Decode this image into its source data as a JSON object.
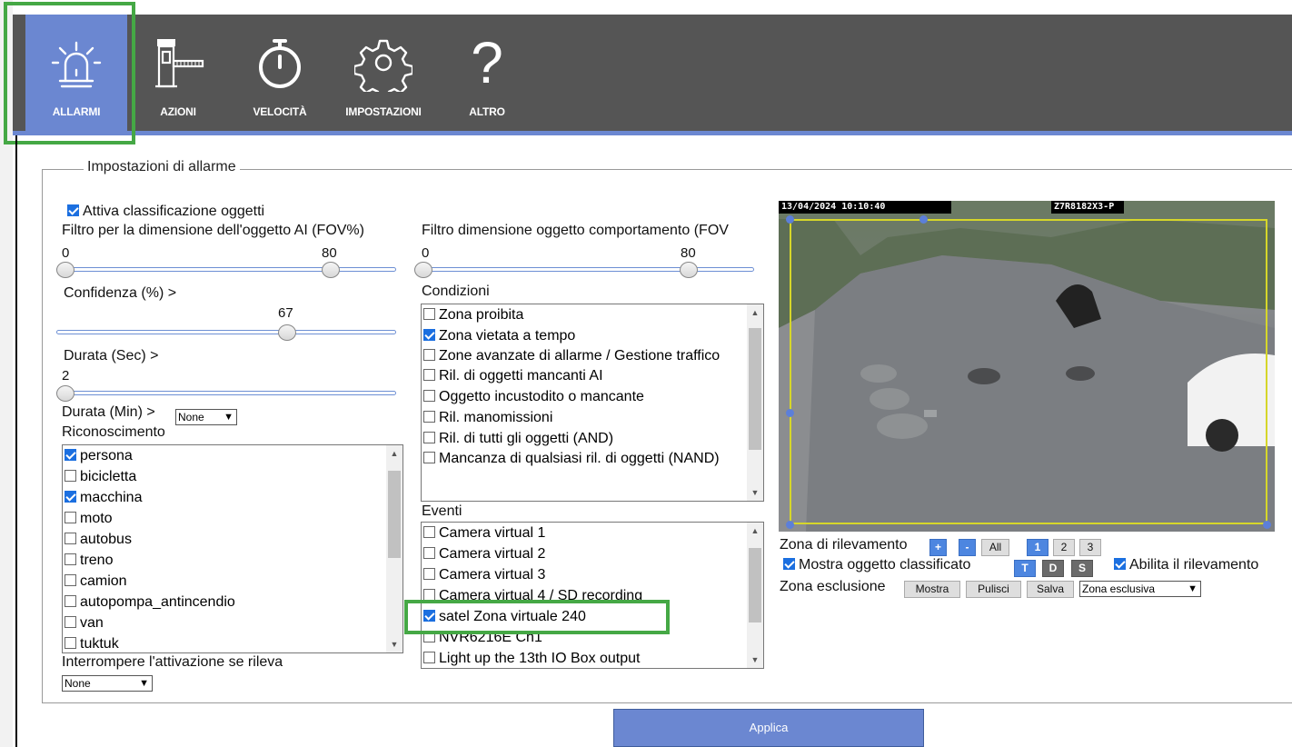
{
  "nav": {
    "tabs": [
      {
        "label": "ALLARMI",
        "icon": "siren-icon",
        "active": true
      },
      {
        "label": "AZIONI",
        "icon": "barrier-icon"
      },
      {
        "label": "VELOCITÀ",
        "icon": "stopwatch-icon"
      },
      {
        "label": "IMPOSTAZIONI",
        "icon": "gear-icon"
      },
      {
        "label": "ALTRO",
        "icon": "question-icon"
      }
    ],
    "accent_color": "#6b87d1",
    "bar_color": "#555555",
    "highlight_color": "#45a845"
  },
  "settings": {
    "legend": "Impostazioni di allarme",
    "object_classification_label": "Attiva classificazione oggetti",
    "object_classification_checked": true,
    "ai_size_filter": {
      "label": "Filtro per la dimensione dell'oggetto AI (FOV%)",
      "min_label": "0",
      "max_label": "80",
      "min": 0,
      "max": 80
    },
    "behavior_size_filter": {
      "label": "Filtro dimensione oggetto comportamento (FOV",
      "min_label": "0",
      "max_label": "80",
      "min": 0,
      "max": 80
    },
    "confidence": {
      "label": "Confidenza (%) >",
      "value_label": "67",
      "value": 67
    },
    "duration_sec": {
      "label": "Durata (Sec) >",
      "value_label": "2",
      "value": 2
    },
    "duration_min": {
      "label": "Durata (Min) >",
      "selected": "None"
    },
    "recognition": {
      "label": "Riconoscimento",
      "items": [
        {
          "label": "persona",
          "checked": true
        },
        {
          "label": "bicicletta",
          "checked": false
        },
        {
          "label": "macchina",
          "checked": true
        },
        {
          "label": "moto",
          "checked": false
        },
        {
          "label": "autobus",
          "checked": false
        },
        {
          "label": "treno",
          "checked": false
        },
        {
          "label": "camion",
          "checked": false
        },
        {
          "label": "autopompa_antincendio",
          "checked": false
        },
        {
          "label": "van",
          "checked": false
        },
        {
          "label": "tuktuk",
          "checked": false
        }
      ]
    },
    "interrupt": {
      "label": "Interrompere l'attivazione se rileva",
      "selected": "None"
    },
    "conditions": {
      "label": "Condizioni",
      "items": [
        {
          "label": "Zona proibita",
          "checked": false
        },
        {
          "label": "Zona vietata a tempo",
          "checked": true
        },
        {
          "label": "Zone avanzate di allarme / Gestione traffico",
          "checked": false
        },
        {
          "label": "Ril. di oggetti mancanti AI",
          "checked": false
        },
        {
          "label": "Oggetto incustodito o mancante",
          "checked": false
        },
        {
          "label": "Ril. manomissioni",
          "checked": false
        },
        {
          "label": "Ril. di tutti gli oggetti (AND)",
          "checked": false
        },
        {
          "label": "Mancanza di qualsiasi ril. di oggetti (NAND)",
          "checked": false
        }
      ]
    },
    "events": {
      "label": "Eventi",
      "items": [
        {
          "label": "Camera virtual 1",
          "checked": false
        },
        {
          "label": "Camera virtual 2",
          "checked": false
        },
        {
          "label": "Camera virtual 3",
          "checked": false
        },
        {
          "label": "Camera virtual 4 / SD recording",
          "checked": false
        },
        {
          "label": "satel Zona virtuale 240",
          "checked": true
        },
        {
          "label": "NVR6216E Ch1",
          "checked": false
        },
        {
          "label": "Light up the 13th IO Box output",
          "checked": false
        }
      ]
    }
  },
  "video": {
    "timestamp": "13/04/2024 10:10:40",
    "camera_id": "Z7R8182X3-P"
  },
  "zone_controls": {
    "detection_label": "Zona di rilevamento",
    "plus": "+",
    "minus": "-",
    "all": "All",
    "zones": [
      "1",
      "2",
      "3"
    ],
    "show_classified_label": "Mostra oggetto classificato",
    "show_classified_checked": true,
    "tds": [
      "T",
      "D",
      "S"
    ],
    "enable_detection_label": "Abilita il rilevamento",
    "enable_detection_checked": true,
    "exclusion_label": "Zona esclusione",
    "show": "Mostra",
    "clear": "Pulisci",
    "save": "Salva",
    "exclusion_select": "Zona esclusiva"
  },
  "apply_label": "Applica"
}
